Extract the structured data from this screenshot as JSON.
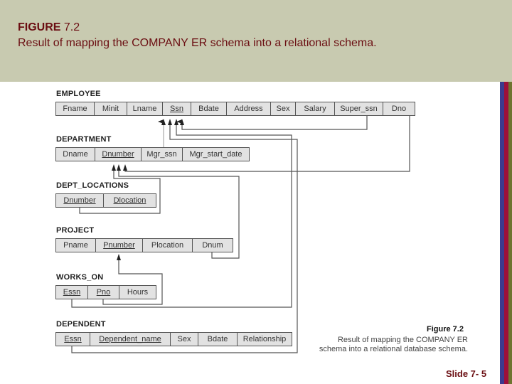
{
  "header": {
    "figure_label": "FIGURE",
    "figure_number": "7.2",
    "subtitle": "Result of mapping the COMPANY ER schema into a relational schema."
  },
  "relations": [
    {
      "name": "EMPLOYEE",
      "attributes": [
        {
          "label": "Fname",
          "pk": false
        },
        {
          "label": "Minit",
          "pk": false
        },
        {
          "label": "Lname",
          "pk": false
        },
        {
          "label": "Ssn",
          "pk": true
        },
        {
          "label": "Bdate",
          "pk": false
        },
        {
          "label": "Address",
          "pk": false
        },
        {
          "label": "Sex",
          "pk": false
        },
        {
          "label": "Salary",
          "pk": false
        },
        {
          "label": "Super_ssn",
          "pk": false
        },
        {
          "label": "Dno",
          "pk": false
        }
      ]
    },
    {
      "name": "DEPARTMENT",
      "attributes": [
        {
          "label": "Dname",
          "pk": false
        },
        {
          "label": "Dnumber",
          "pk": true
        },
        {
          "label": "Mgr_ssn",
          "pk": false
        },
        {
          "label": "Mgr_start_date",
          "pk": false
        }
      ]
    },
    {
      "name": "DEPT_LOCATIONS",
      "attributes": [
        {
          "label": "Dnumber",
          "pk": true
        },
        {
          "label": "Dlocation",
          "pk": true
        }
      ]
    },
    {
      "name": "PROJECT",
      "attributes": [
        {
          "label": "Pname",
          "pk": false
        },
        {
          "label": "Pnumber",
          "pk": true
        },
        {
          "label": "Plocation",
          "pk": false
        },
        {
          "label": "Dnum",
          "pk": false
        }
      ]
    },
    {
      "name": "WORKS_ON",
      "attributes": [
        {
          "label": "Essn",
          "pk": true
        },
        {
          "label": "Pno",
          "pk": true
        },
        {
          "label": "Hours",
          "pk": false
        }
      ]
    },
    {
      "name": "DEPENDENT",
      "attributes": [
        {
          "label": "Essn",
          "pk": true
        },
        {
          "label": "Dependent_name",
          "pk": true
        },
        {
          "label": "Sex",
          "pk": false
        },
        {
          "label": "Bdate",
          "pk": false
        },
        {
          "label": "Relationship",
          "pk": false
        }
      ]
    }
  ],
  "foreign_keys": [
    {
      "from": "EMPLOYEE.Super_ssn",
      "to": "EMPLOYEE.Ssn"
    },
    {
      "from": "DEPARTMENT.Mgr_ssn",
      "to": "EMPLOYEE.Ssn"
    },
    {
      "from": "WORKS_ON.Essn",
      "to": "EMPLOYEE.Ssn"
    },
    {
      "from": "DEPENDENT.Essn",
      "to": "EMPLOYEE.Ssn"
    },
    {
      "from": "EMPLOYEE.Dno",
      "to": "DEPARTMENT.Dnumber"
    },
    {
      "from": "DEPT_LOCATIONS.Dnumber",
      "to": "DEPARTMENT.Dnumber"
    },
    {
      "from": "PROJECT.Dnum",
      "to": "DEPARTMENT.Dnumber"
    },
    {
      "from": "WORKS_ON.Pno",
      "to": "PROJECT.Pnumber"
    }
  ],
  "caption": {
    "heading": "Figure 7.2",
    "line1": "Result of mapping the COMPANY ER",
    "line2": "schema into a relational database schema."
  },
  "footer": {
    "slide_label": "Slide 7- 5"
  }
}
